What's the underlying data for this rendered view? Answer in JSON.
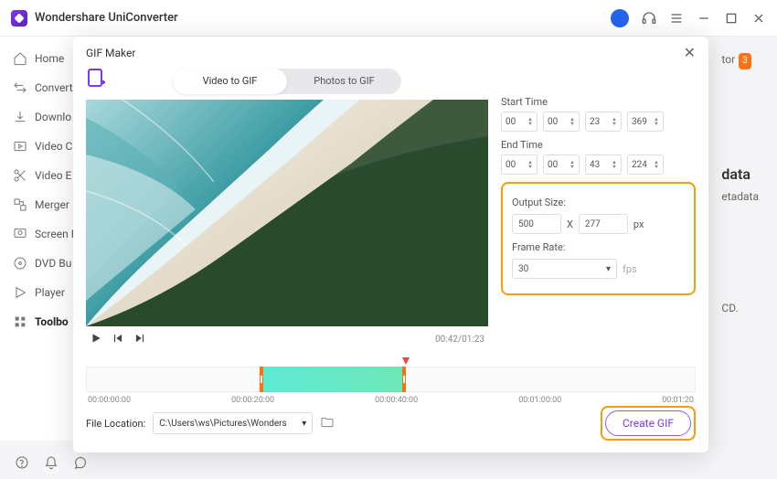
{
  "app": {
    "title": "Wondershare UniConverter"
  },
  "sidebar": {
    "items": [
      {
        "label": "Home"
      },
      {
        "label": "Convert"
      },
      {
        "label": "Downlo"
      },
      {
        "label": "Video C"
      },
      {
        "label": "Video E"
      },
      {
        "label": "Merger"
      },
      {
        "label": "Screen R"
      },
      {
        "label": "DVD Bu"
      },
      {
        "label": "Player"
      },
      {
        "label": "Toolbo"
      }
    ]
  },
  "background": {
    "tor_label": "tor",
    "tor_badge": "3",
    "data_heading": "data",
    "data_sub": "etadata",
    "cd_text": "CD."
  },
  "modal": {
    "title": "GIF Maker",
    "tabs": {
      "video": "Video to GIF",
      "photos": "Photos to GIF"
    },
    "preview": {
      "current": "00:42/01:23"
    },
    "start_time_label": "Start Time",
    "end_time_label": "End Time",
    "start": {
      "h": "00",
      "m": "00",
      "s": "23",
      "ms": "369"
    },
    "end": {
      "h": "00",
      "m": "00",
      "s": "43",
      "ms": "224"
    },
    "output_size_label": "Output Size:",
    "width": "500",
    "x": "X",
    "height": "277",
    "px": "px",
    "frame_rate_label": "Frame Rate:",
    "frame_rate": "30",
    "fps": "fps",
    "ticks": [
      "00:00:00:00",
      "00:00:20:00",
      "00:00:40:00",
      "00:01:00:00",
      "00:01:20"
    ],
    "file_location_label": "File Location:",
    "file_location": "C:\\Users\\ws\\Pictures\\Wonders",
    "create_btn": "Create GIF"
  }
}
